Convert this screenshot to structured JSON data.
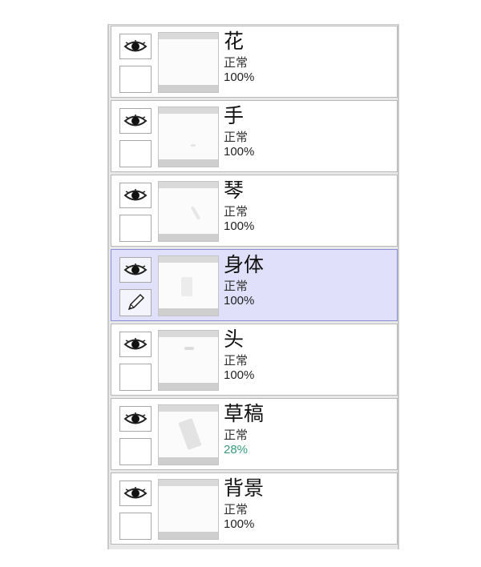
{
  "layers_panel": {
    "accent_selected": "#e0e0fa",
    "opacity_low_color": "#3a9a78",
    "layers": [
      {
        "name": "花",
        "mode": "正常",
        "opacity": "100%",
        "visible": true,
        "selected": false
      },
      {
        "name": "手",
        "mode": "正常",
        "opacity": "100%",
        "visible": true,
        "selected": false
      },
      {
        "name": "琴",
        "mode": "正常",
        "opacity": "100%",
        "visible": true,
        "selected": false
      },
      {
        "name": "身体",
        "mode": "正常",
        "opacity": "100%",
        "visible": true,
        "selected": true,
        "edit_icon": "pencil-icon"
      },
      {
        "name": "头",
        "mode": "正常",
        "opacity": "100%",
        "visible": true,
        "selected": false
      },
      {
        "name": "草稿",
        "mode": "正常",
        "opacity": "28%",
        "visible": true,
        "selected": false
      },
      {
        "name": "背景",
        "mode": "正常",
        "opacity": "100%",
        "visible": true,
        "selected": false
      }
    ]
  }
}
